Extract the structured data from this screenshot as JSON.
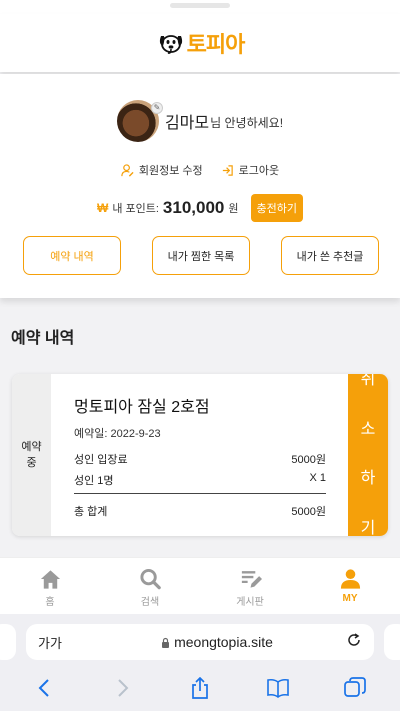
{
  "header": {
    "logo_text": "토피아",
    "logo_icon": "dog-logo-icon"
  },
  "profile": {
    "name": "김마모",
    "greeting_suffix": "님 안녕하세요!",
    "edit_profile_label": "회원정보 수정",
    "logout_label": "로그아웃",
    "points_label": "내 포인트:",
    "points_value": "310,000",
    "points_unit": "원",
    "charge_label": "충전하기"
  },
  "tabs": [
    {
      "label": "예약 내역",
      "active": true
    },
    {
      "label": "내가 찜한 목록",
      "active": false
    },
    {
      "label": "내가 쓴 추천글",
      "active": false
    }
  ],
  "section_title": "예약 내역",
  "reservation": {
    "status_line1": "예약",
    "status_line2": "중",
    "place": "멍토피아 잠실 2호점",
    "date": "예약일: 2022-9-23",
    "items": [
      {
        "name": "성인 입장료",
        "value": "5000원"
      },
      {
        "name": "성인 1명",
        "value": "X 1"
      }
    ],
    "total_label": "총 합계",
    "total_value": "5000원",
    "cancel_chars": [
      "취",
      "소",
      "하",
      "기"
    ]
  },
  "bottom_nav": [
    {
      "label": "홈",
      "icon": "home-icon",
      "active": false
    },
    {
      "label": "검색",
      "icon": "search-icon",
      "active": false
    },
    {
      "label": "게시판",
      "icon": "board-icon",
      "active": false
    },
    {
      "label": "MY",
      "icon": "user-icon",
      "active": true
    }
  ],
  "browser": {
    "text_size_label": "가가",
    "url": "meongtopia.site"
  },
  "colors": {
    "accent": "#f5a00a",
    "inactive": "#999999"
  }
}
